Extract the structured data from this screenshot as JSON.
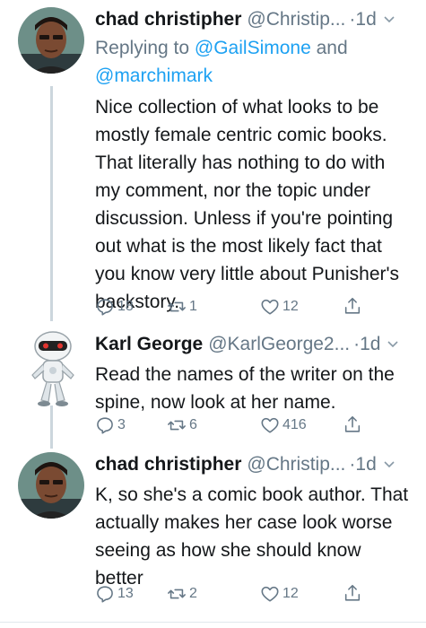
{
  "colors": {
    "link": "#1da1f2",
    "secondary_text": "#657786",
    "primary_text": "#14171a",
    "thread_line": "#ccd6dd"
  },
  "tweets": [
    {
      "name": "chad christipher",
      "handle": "@Christip...",
      "time": "·1d",
      "chevron_icon": "chevron-down-icon",
      "reply_prefix": "Replying to ",
      "reply_user1": "@GailSimone",
      "reply_and": " and",
      "reply_user2": "@marchimark",
      "text": "Nice collection of what looks to be mostly female centric comic books. That literally has nothing to do with my comment, nor the topic under discussion. Unless if you're pointing out what is the most likely fact that you know very little about Punisher's backstory.",
      "replies": "18",
      "retweets": "1",
      "likes": "12"
    },
    {
      "name": "Karl George",
      "handle": "@KarlGeorge2...",
      "time": "·1d",
      "chevron_icon": "chevron-down-icon",
      "text": "Read the names of the writer on the spine, now look at her name.",
      "replies": "3",
      "retweets": "6",
      "likes": "416"
    },
    {
      "name": "chad christipher",
      "handle": "@Christip...",
      "time": "·1d",
      "chevron_icon": "chevron-down-icon",
      "text": "K, so she's a comic book author. That actually makes her case look worse seeing as how she should know better",
      "replies": "13",
      "retweets": "2",
      "likes": "12"
    }
  ]
}
